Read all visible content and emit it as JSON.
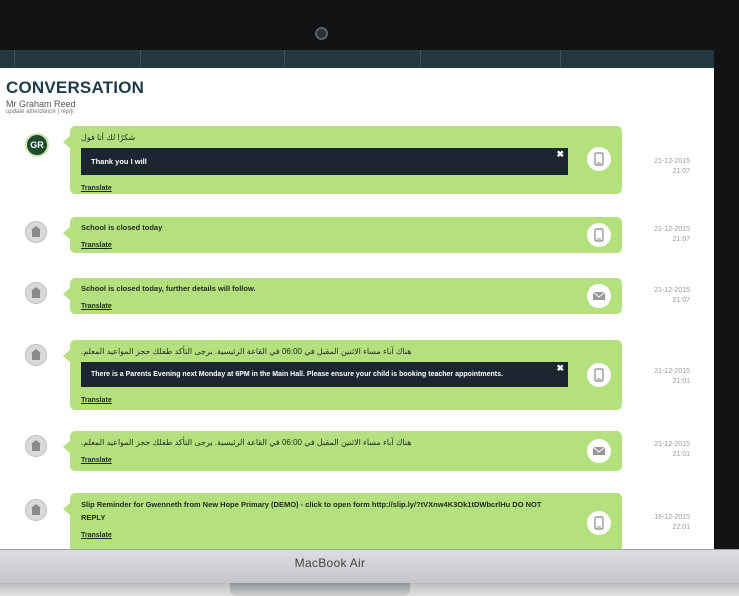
{
  "header": {
    "title": "CONVERSATION",
    "sender": "Mr Graham Reed",
    "links": "update attendance | reply"
  },
  "device": {
    "brand": "MacBook Air"
  },
  "messages": [
    {
      "avatar_text": "GR",
      "arabic": "شكرًا لك أنا فول",
      "popup": "Thank you I will",
      "translate": "Translate",
      "icon": "phone-icon",
      "date": "21-12-2015",
      "time": "21:07"
    },
    {
      "text": "School is closed today",
      "translate": "Translate",
      "icon": "phone-icon",
      "date": "21-12-2015",
      "time": "21:07"
    },
    {
      "text": "School is closed today, further details will follow.",
      "translate": "Translate",
      "icon": "email-icon",
      "date": "21-12-2015",
      "time": "21:07"
    },
    {
      "arabic": "هناك آباء مساء الاثنين المقبل في 06:00 في القاعة الرئيسية. يرجى التأكد طفلك حجز المواعيد المعلم.",
      "popup": "There is a Parents Evening next Monday at 6PM in the Main Hall. Please ensure your child is booking teacher appointments.",
      "translate": "Translate",
      "icon": "phone-icon",
      "date": "21-12-2015",
      "time": "21:01"
    },
    {
      "arabic": "هناك آباء مساء الاثنين المقبل في 06:00 في القاعة الرئيسية. يرجى التأكد طفلك حجز المواعيد المعلم.",
      "translate": "Translate",
      "icon": "email-icon",
      "date": "21-12-2015",
      "time": "21:01"
    },
    {
      "text": "Slip Reminder for Gwenneth from New Hope Primary (DEMO) - click to open form http://slip.ly/?tVXnw4K3Ok1tDWbcrlHu DO NOT REPLY",
      "translate": "Translate",
      "icon": "phone-icon",
      "date": "16-12-2015",
      "time": "22:01"
    }
  ]
}
